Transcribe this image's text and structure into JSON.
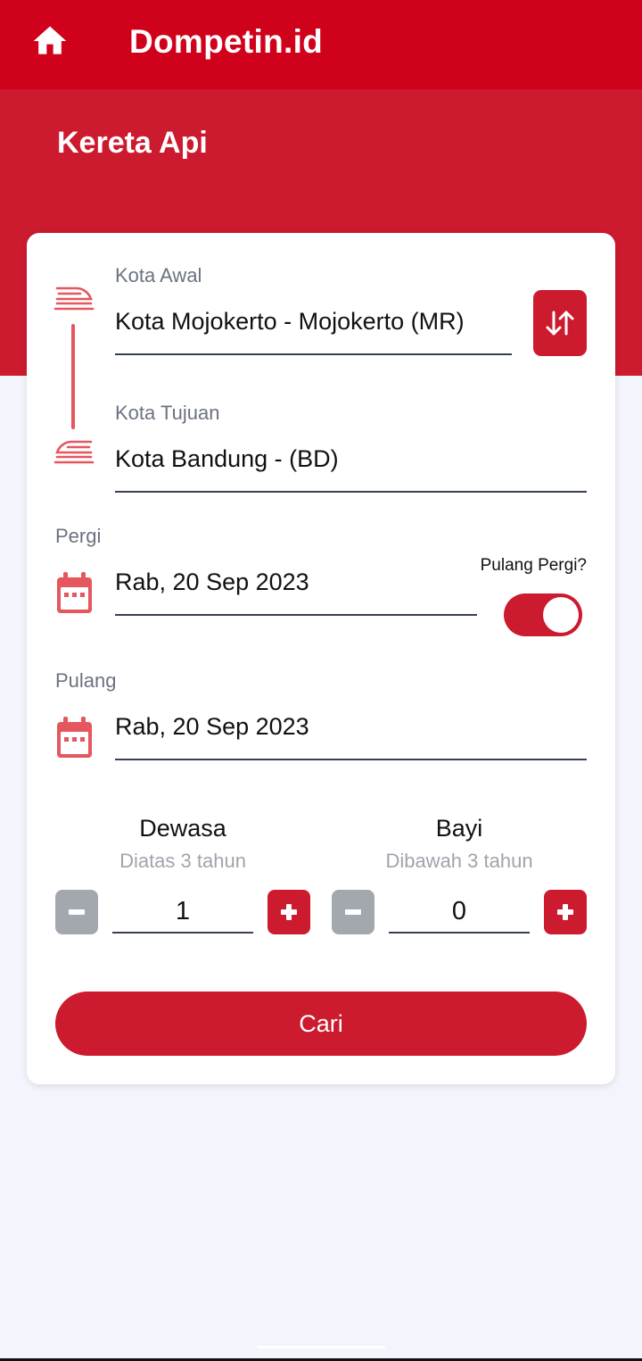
{
  "appbar": {
    "title": "Dompetin.id",
    "home_icon": "home-icon"
  },
  "hero": {
    "title": "Kereta Api"
  },
  "form": {
    "origin": {
      "label": "Kota Awal",
      "value": "Kota Mojokerto - Mojokerto (MR)",
      "icon": "train-departure-icon"
    },
    "destination": {
      "label": "Kota Tujuan",
      "value": "Kota Bandung -  (BD)",
      "icon": "train-arrival-icon"
    },
    "swap_icon": "swap-vertical-icon",
    "depart": {
      "label": "Pergi",
      "value": "Rab, 20 Sep 2023",
      "icon": "calendar-icon"
    },
    "round_trip": {
      "label": "Pulang Pergi?",
      "enabled": true
    },
    "return": {
      "label": "Pulang",
      "value": "Rab, 20 Sep 2023",
      "icon": "calendar-icon"
    },
    "adult": {
      "title": "Dewasa",
      "subtitle": "Diatas 3 tahun",
      "count": "1"
    },
    "infant": {
      "title": "Bayi",
      "subtitle": "Dibawah 3 tahun",
      "count": "0"
    },
    "search_label": "Cari"
  },
  "colors": {
    "appbar": "#D0021B",
    "primary": "#CC1A2F",
    "icon_red": "#E5565F",
    "background": "#F3F4FC",
    "minus_gray": "#A3A7AE"
  }
}
